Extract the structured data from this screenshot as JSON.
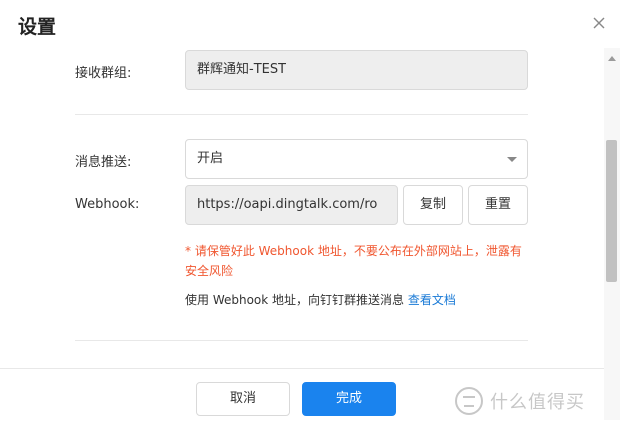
{
  "header": {
    "title": "设置"
  },
  "form": {
    "group_label": "接收群组:",
    "group_value": "群辉通知-TEST",
    "push_label": "消息推送:",
    "push_value": "开启",
    "webhook_label": "Webhook:",
    "webhook_value": "https://oapi.dingtalk.com/ro",
    "copy_label": "复制",
    "reset_label": "重置",
    "warning_line1": "* 请保管好此 Webhook 地址，不要公布在外部网站上，泄露有",
    "warning_line2": "安全风险",
    "hint_text": "使用 Webhook 地址，向钉钉群推送消息 ",
    "hint_link": "查看文档"
  },
  "footer": {
    "cancel_label": "取消",
    "done_label": "完成"
  },
  "watermark": {
    "text": "什么值得买"
  },
  "colors": {
    "primary": "#1a83ee",
    "warning": "#f0562f",
    "link": "#1a7ad6"
  }
}
